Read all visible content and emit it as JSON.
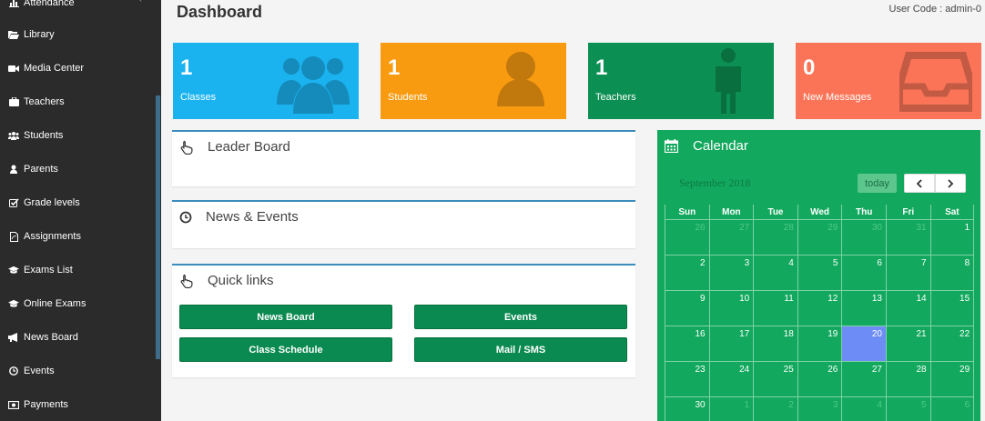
{
  "sidebar": {
    "items": [
      {
        "label": "Attendance",
        "icon": "chart-icon"
      },
      {
        "label": "Library",
        "icon": "folder-open-icon"
      },
      {
        "label": "Media Center",
        "icon": "video-camera-icon"
      },
      {
        "label": "Teachers",
        "icon": "briefcase-icon"
      },
      {
        "label": "Students",
        "icon": "users-icon"
      },
      {
        "label": "Parents",
        "icon": "user-icon"
      },
      {
        "label": "Grade levels",
        "icon": "checkbox-icon"
      },
      {
        "label": "Assignments",
        "icon": "file-pdf-icon"
      },
      {
        "label": "Exams List",
        "icon": "graduation-cap-icon"
      },
      {
        "label": "Online Exams",
        "icon": "graduation-cap-icon"
      },
      {
        "label": "News Board",
        "icon": "bullhorn-icon"
      },
      {
        "label": "Events",
        "icon": "clock-icon"
      },
      {
        "label": "Payments",
        "icon": "money-icon"
      }
    ]
  },
  "header": {
    "title": "Dashboard",
    "user_code": "User Code : admin-0"
  },
  "stats": [
    {
      "value": "1",
      "label": "Classes",
      "color": "#1ab3f0",
      "icon": "users-icon"
    },
    {
      "value": "1",
      "label": "Students",
      "color": "#f99b10",
      "icon": "user-icon"
    },
    {
      "value": "1",
      "label": "Teachers",
      "color": "#0c8f52",
      "icon": "male-icon"
    },
    {
      "value": "0",
      "label": "New Messages",
      "color": "#fb7458",
      "icon": "inbox-icon"
    }
  ],
  "panels": {
    "leader_board": {
      "title": "Leader Board",
      "icon": "hand-pointer-icon"
    },
    "news_events": {
      "title": "News & Events",
      "icon": "clock-icon"
    },
    "quick_links": {
      "title": "Quick links",
      "icon": "hand-pointer-icon",
      "buttons": [
        "News Board",
        "Events",
        "Class Schedule",
        "Mail / SMS"
      ]
    }
  },
  "calendar": {
    "title": "Calendar",
    "icon": "calendar-icon",
    "month": "September 2018",
    "today_label": "today",
    "prev_icon": "chevron-left-icon",
    "next_icon": "chevron-right-icon",
    "days_of_week": [
      "Sun",
      "Mon",
      "Tue",
      "Wed",
      "Thu",
      "Fri",
      "Sat"
    ],
    "weeks": [
      [
        "26",
        "27",
        "28",
        "29",
        "30",
        "31",
        "1"
      ],
      [
        "2",
        "3",
        "4",
        "5",
        "6",
        "7",
        "8"
      ],
      [
        "9",
        "10",
        "11",
        "12",
        "13",
        "14",
        "15"
      ],
      [
        "16",
        "17",
        "18",
        "19",
        "20",
        "21",
        "22"
      ],
      [
        "23",
        "24",
        "25",
        "26",
        "27",
        "28",
        "29"
      ],
      [
        "30",
        "1",
        "2",
        "3",
        "4",
        "5",
        "6"
      ]
    ],
    "today_day": "20",
    "colors": {
      "background": "#12a85d",
      "today": "#6d8cf5"
    }
  }
}
